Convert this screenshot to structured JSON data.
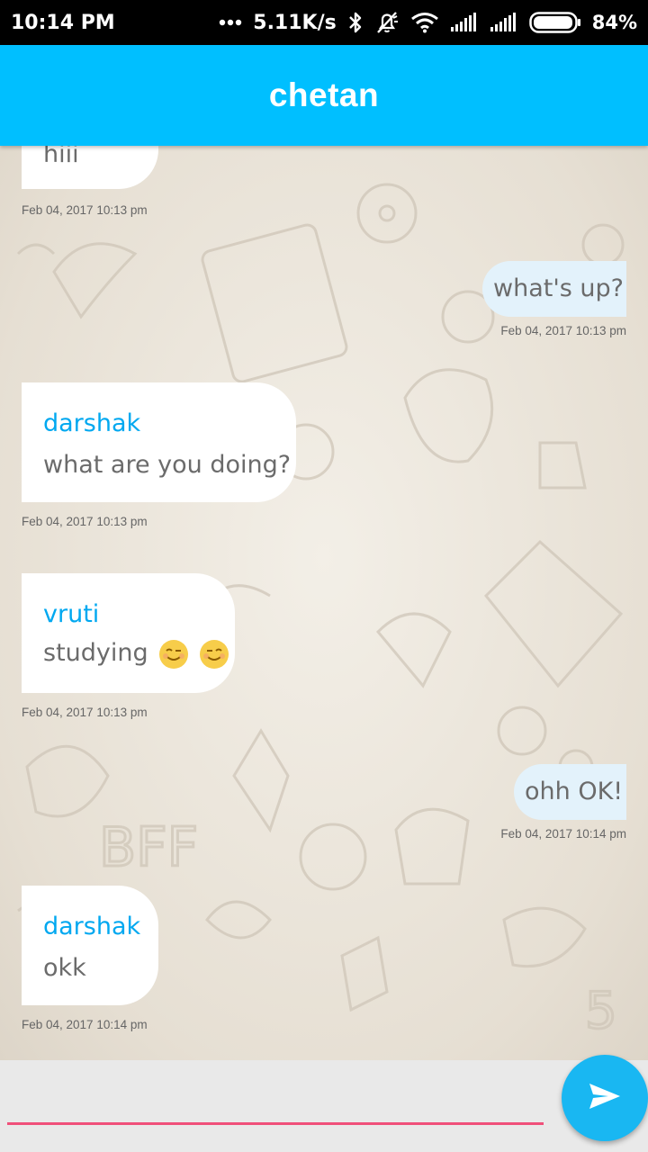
{
  "status_bar": {
    "time": "10:14 PM",
    "network_speed": "5.11K/s",
    "battery_percent": "84%",
    "icons": [
      "more-dots-icon",
      "bluetooth-icon",
      "alarm-off-icon",
      "wifi-icon",
      "signal-icon",
      "signal-icon",
      "battery-icon"
    ]
  },
  "app_bar": {
    "title": "chetan"
  },
  "messages": [
    {
      "direction": "incoming",
      "sender": "",
      "text": "hiii",
      "timestamp": "Feb 04, 2017 10:13 pm"
    },
    {
      "direction": "outgoing",
      "text": "what's up?",
      "timestamp": "Feb 04, 2017 10:13 pm"
    },
    {
      "direction": "incoming",
      "sender": "darshak",
      "text": "what are you doing?",
      "timestamp": "Feb 04, 2017 10:13 pm"
    },
    {
      "direction": "incoming",
      "sender": "vruti",
      "text": "studying",
      "emoji": [
        "wink-emoji",
        "wink-emoji"
      ],
      "timestamp": "Feb 04, 2017 10:13 pm"
    },
    {
      "direction": "outgoing",
      "text": "ohh OK!",
      "timestamp": "Feb 04, 2017 10:14 pm"
    },
    {
      "direction": "incoming",
      "sender": "darshak",
      "text": "okk",
      "timestamp": "Feb 04, 2017 10:14 pm"
    }
  ],
  "input": {
    "value": "",
    "placeholder": ""
  },
  "send_button": {
    "icon": "send-icon"
  },
  "colors": {
    "app_bar": "#00bfff",
    "sender_name": "#00a8f0",
    "send_button": "#19b7f2",
    "input_underline": "#f0507a",
    "outgoing_bubble": "#e3f2fb",
    "incoming_bubble": "#ffffff"
  }
}
